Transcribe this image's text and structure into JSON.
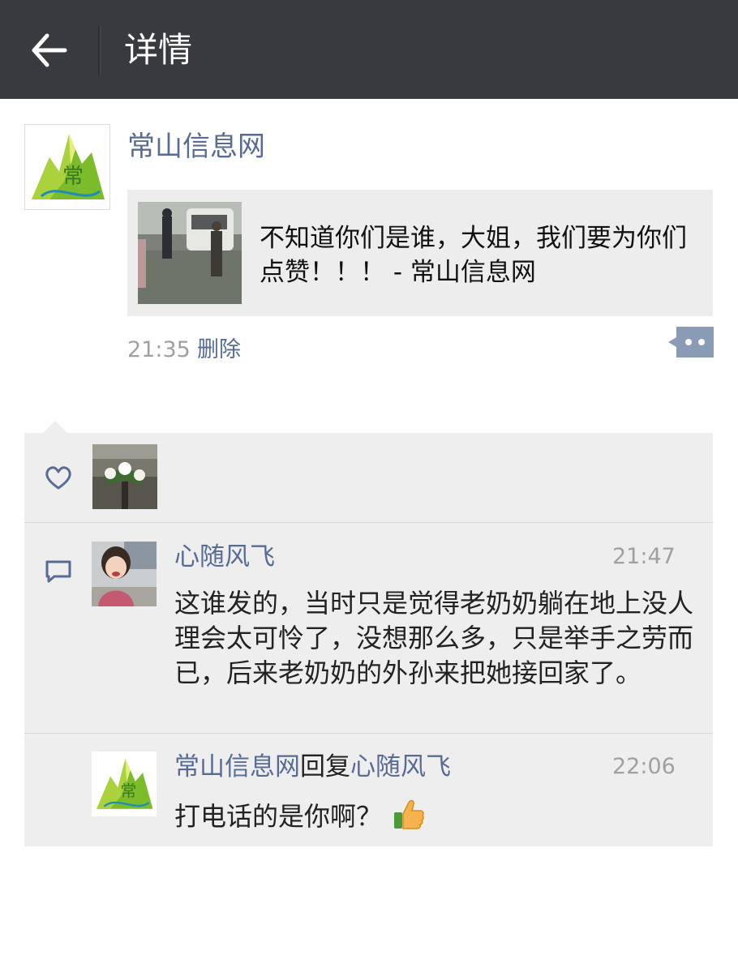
{
  "header": {
    "title": "详情",
    "back_icon": "back-arrow-icon"
  },
  "post": {
    "author": "常山信息网",
    "share_text": "不知道你们是谁，大姐，我们要为你们点赞！！！ - 常山信息网",
    "time": "21:35",
    "delete_label": "删除",
    "more_icon": "more-options-icon"
  },
  "likes": {
    "icon": "heart-icon"
  },
  "comments": [
    {
      "author": "心随风飞",
      "time": "21:47",
      "text": "这谁发的，当时只是觉得老奶奶躺在地上没人理会太可怜了，没想那么多，只是举手之劳而已，后来老奶奶的外孙来把她接回家了。"
    },
    {
      "author": "常山信息网",
      "reply_word": "回复",
      "reply_to": "心随风飞",
      "time": "22:06",
      "text": "打电话的是你啊？",
      "emoji": "thumbs-up-icon"
    }
  ],
  "colors": {
    "header_bg": "#393a3f",
    "link": "#576b95",
    "panel_bg": "#eeeeee",
    "share_bg": "#ededed"
  }
}
